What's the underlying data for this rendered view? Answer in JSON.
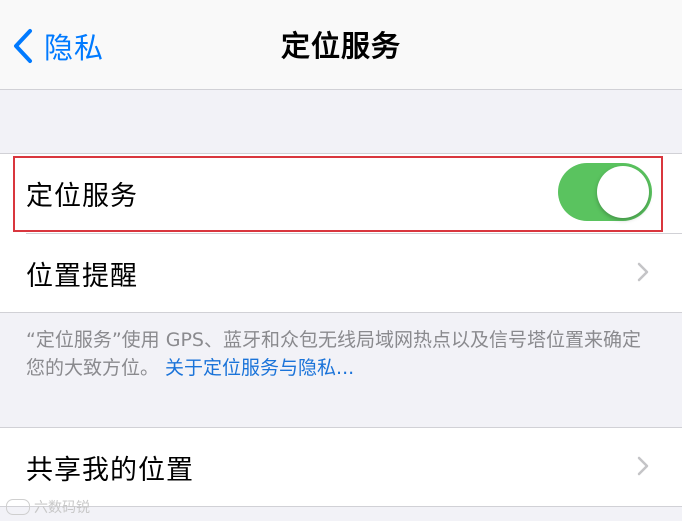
{
  "nav": {
    "back_label": "隐私",
    "title": "定位服务"
  },
  "rows": {
    "location_services": {
      "label": "定位服务",
      "toggle_on": true
    },
    "location_alerts": {
      "label": "位置提醒"
    },
    "share_my_location": {
      "label": "共享我的位置"
    }
  },
  "footnote": {
    "text": "“定位服务”使用 GPS、蓝牙和众包无线局域网热点以及信号塔位置来确定您的大致方位。 ",
    "link": "关于定位服务与隐私..."
  },
  "watermark": {
    "text": "六数码锐"
  },
  "colors": {
    "accent": "#007aff",
    "toggle_on": "#5ac35f",
    "highlight_border": "#d9363e",
    "background": "#f2f2f7"
  },
  "icons": {
    "back": "chevron-left-icon",
    "disclosure": "chevron-right-icon"
  }
}
